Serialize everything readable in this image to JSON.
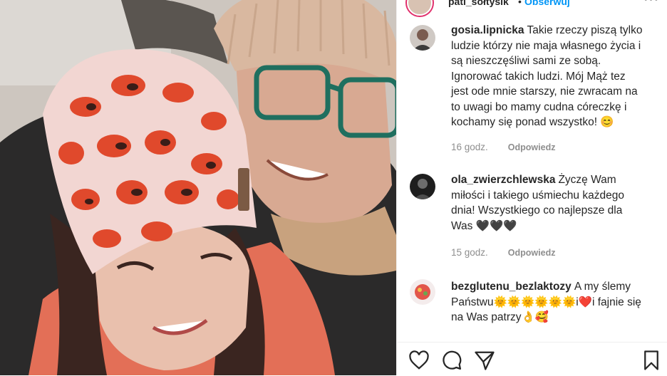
{
  "header": {
    "username": "pati_sołtysik",
    "separator": "•",
    "follow_label": "Obserwuj",
    "more_label": "•••"
  },
  "comments": [
    {
      "username": "gosia.lipnicka",
      "text": "Takie rzeczy piszą tylko ludzie którzy nie maja własnego życia i są nieszczęśliwi sami ze sobą. Ignorować takich ludzi. Mój Mąż tez jest ode mnie starszy, nie zwracam na to uwagi bo mamy cudna córeczkę i kochamy się ponad wszystko! 😊",
      "time": "16 godz.",
      "reply_label": "Odpowiedz"
    },
    {
      "username": "ola_zwierzchlewska",
      "text": "Życzę Wam miłości i takiego uśmiechu każdego dnia! Wszystkiego co najlepsze dla Was 🖤🖤🖤",
      "time": "15 godz.",
      "reply_label": "Odpowiedz"
    },
    {
      "username": "bezglutenu_bezlaktozy",
      "text": "A my ślemy Państwu🌞🌞🌞🌞🌞🌞i❤️i fajnie się na Was patrzy👌🥰",
      "time": "",
      "reply_label": ""
    }
  ],
  "actions": {
    "like_icon": "heart-outline-icon",
    "comment_icon": "comment-bubble-icon",
    "share_icon": "paper-plane-icon",
    "save_icon": "bookmark-icon"
  },
  "colors": {
    "follow": "#0095f6",
    "meta": "#8e8e8e",
    "text": "#262626"
  }
}
